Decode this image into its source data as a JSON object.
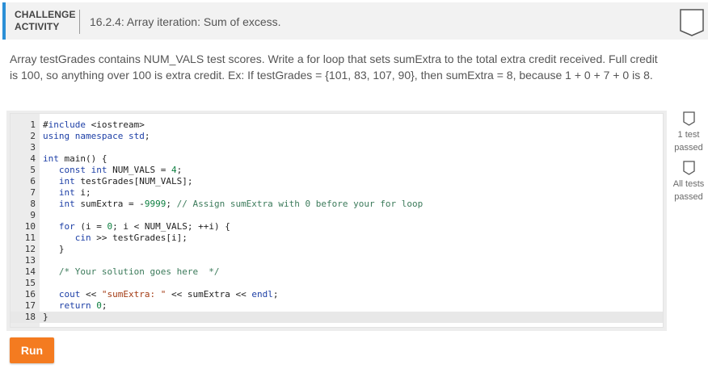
{
  "header": {
    "label_line1": "CHALLENGE",
    "label_line2": "ACTIVITY",
    "title": "16.2.4: Array iteration: Sum of excess.",
    "accent_color": "#2b8fd6",
    "bookmark_icon": "bookmark-badge-icon"
  },
  "description": "Array testGrades contains NUM_VALS test scores. Write a for loop that sets sumExtra to the total extra credit received. Full credit is 100, so anything over 100 is extra credit. Ex: If testGrades = {101, 83, 107, 90}, then sumExtra = 8, because 1 + 0 + 7 + 0 is 8.",
  "editor": {
    "lines": [
      {
        "num": "1",
        "text": "#include <iostream>"
      },
      {
        "num": "2",
        "text": "using namespace std;"
      },
      {
        "num": "3",
        "text": ""
      },
      {
        "num": "4",
        "text": "int main() {"
      },
      {
        "num": "5",
        "text": "   const int NUM_VALS = 4;"
      },
      {
        "num": "6",
        "text": "   int testGrades[NUM_VALS];"
      },
      {
        "num": "7",
        "text": "   int i;"
      },
      {
        "num": "8",
        "text": "   int sumExtra = -9999; // Assign sumExtra with 0 before your for loop"
      },
      {
        "num": "9",
        "text": ""
      },
      {
        "num": "10",
        "text": "   for (i = 0; i < NUM_VALS; ++i) {"
      },
      {
        "num": "11",
        "text": "      cin >> testGrades[i];"
      },
      {
        "num": "12",
        "text": "   }"
      },
      {
        "num": "13",
        "text": ""
      },
      {
        "num": "14",
        "text": "   /* Your solution goes here  */"
      },
      {
        "num": "15",
        "text": ""
      },
      {
        "num": "16",
        "text": "   cout << \"sumExtra: \" << sumExtra << endl;"
      },
      {
        "num": "17",
        "text": "   return 0;"
      },
      {
        "num": "18",
        "text": "}"
      }
    ],
    "active_line": 18
  },
  "status": {
    "test1": "1 test passed",
    "all": "All tests passed"
  },
  "run_label": "Run",
  "colors": {
    "run_button": "#f47b20",
    "keyword": "#1d3fa6",
    "comment": "#3b7a5a",
    "string": "#a43c15"
  }
}
